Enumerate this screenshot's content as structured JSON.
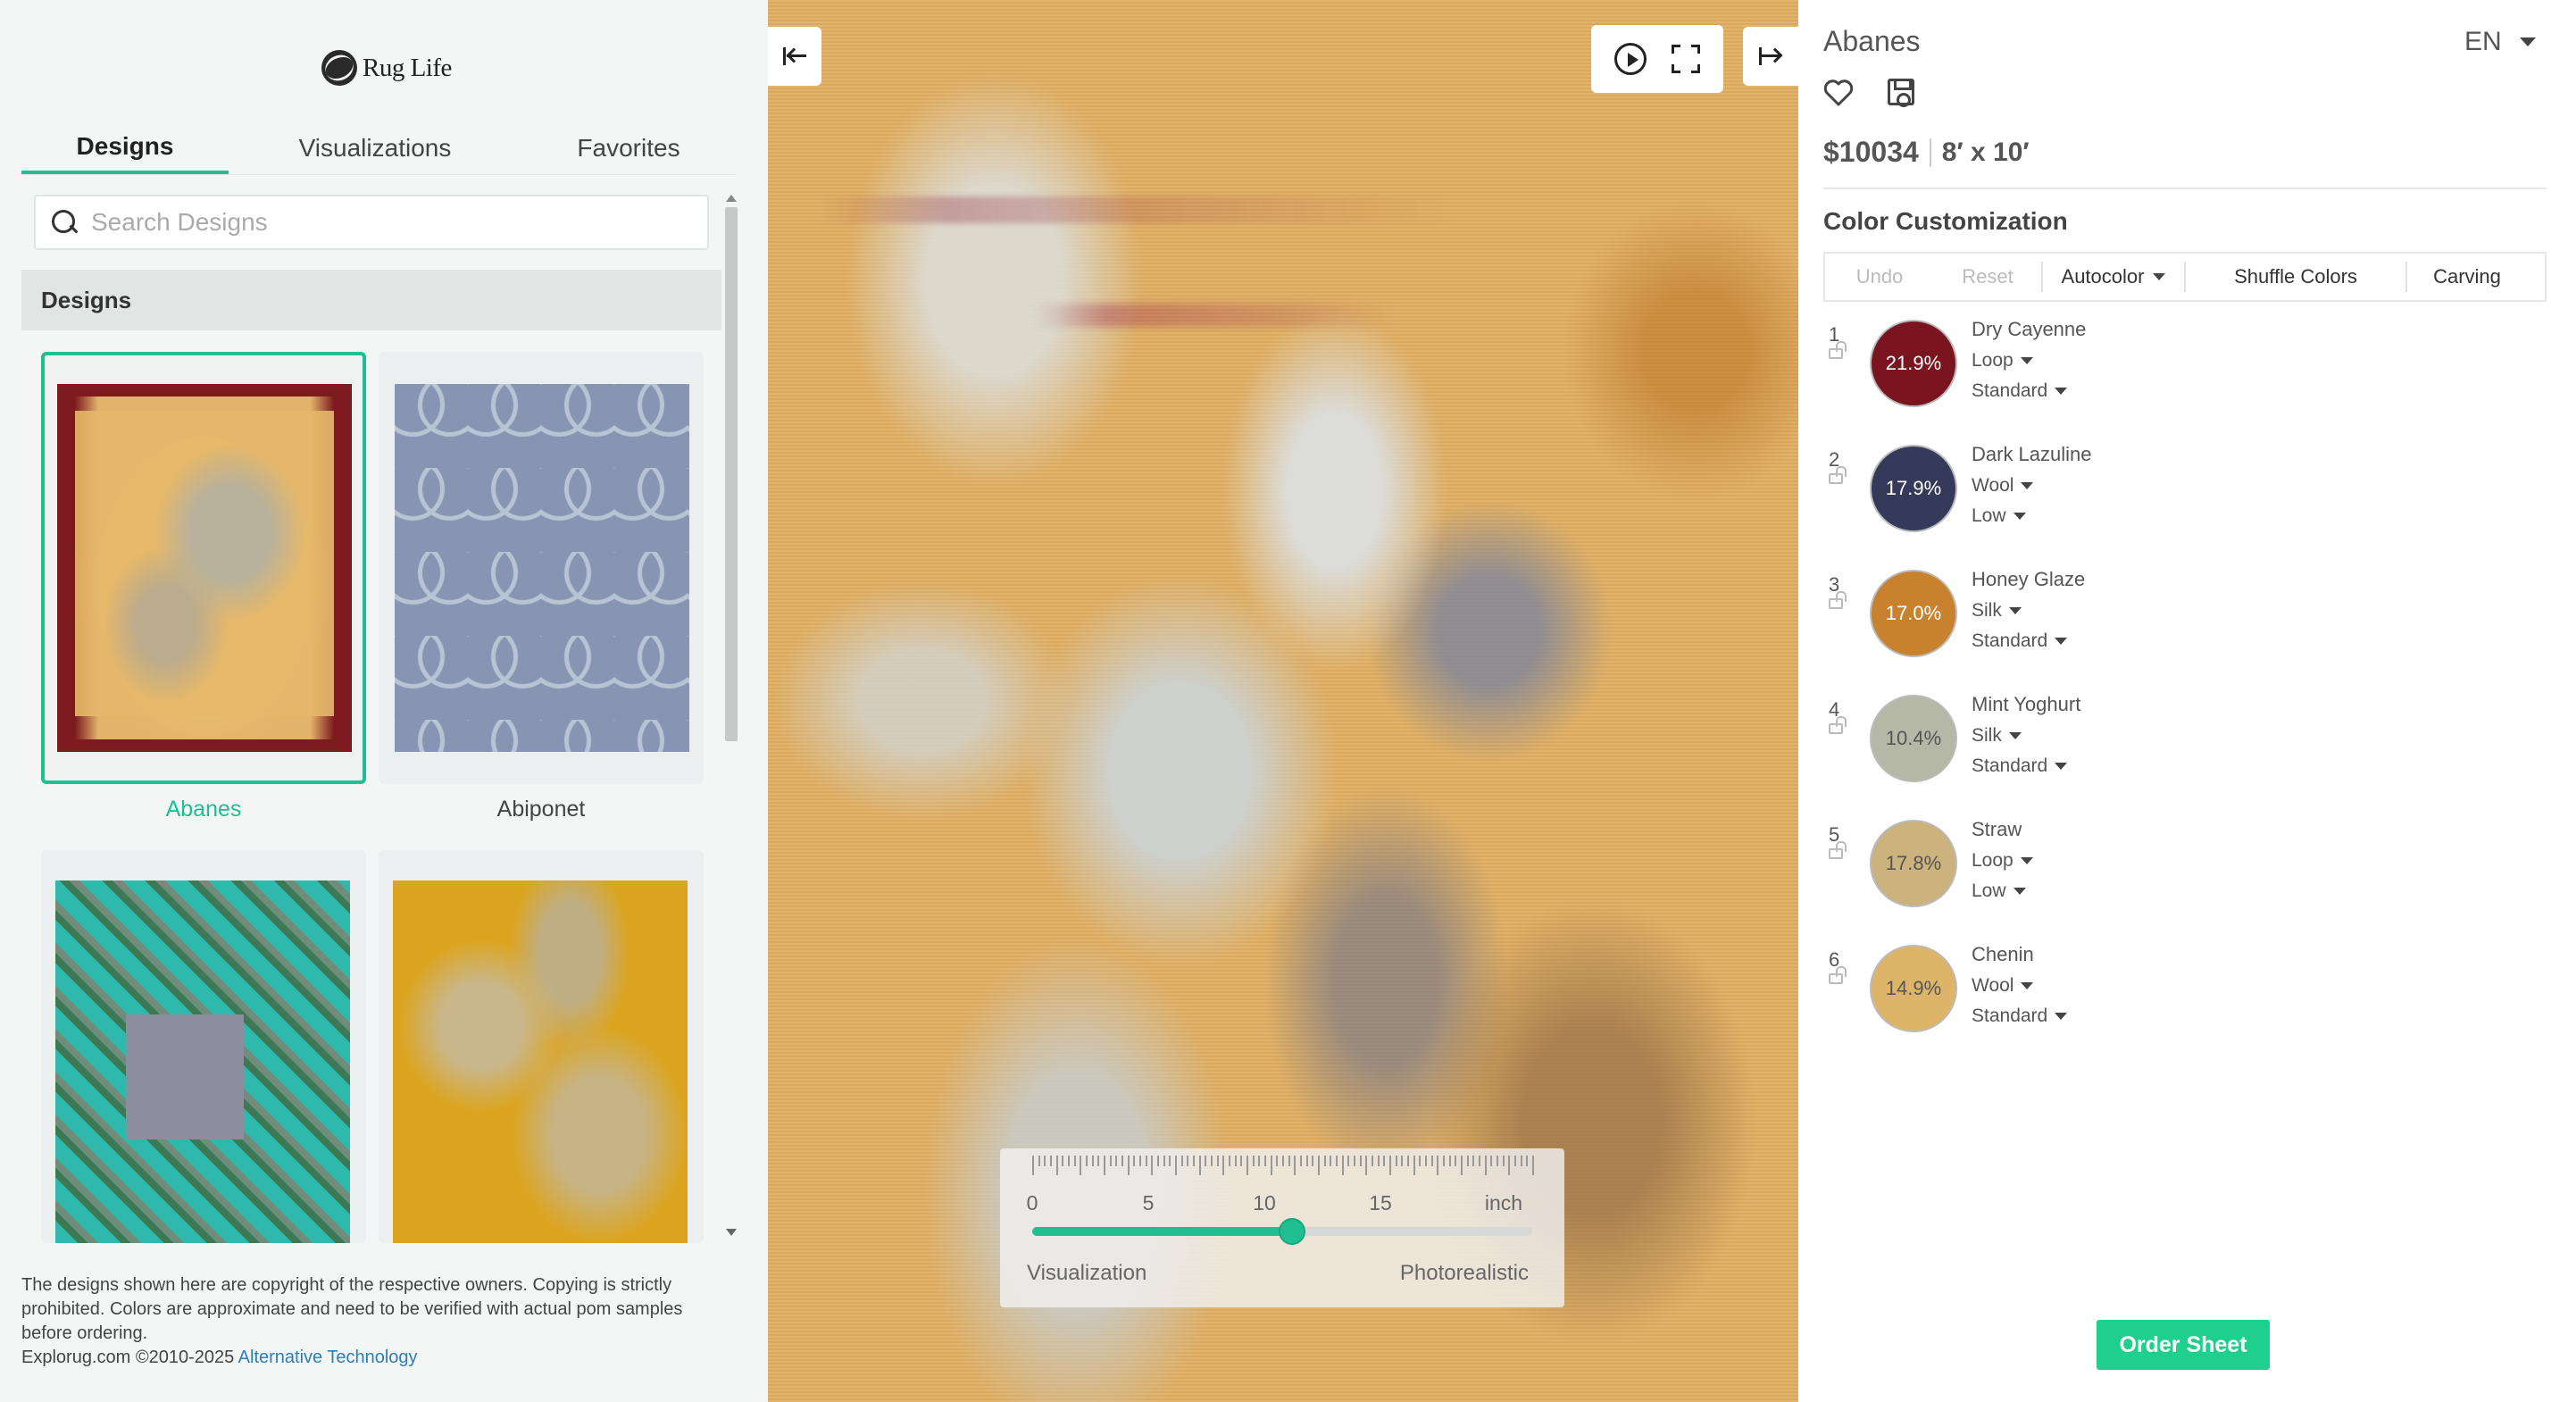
{
  "brand": {
    "logo_text": "Rug Life"
  },
  "left": {
    "tabs": [
      {
        "label": "Designs",
        "active": true
      },
      {
        "label": "Visualizations",
        "active": false
      },
      {
        "label": "Favorites",
        "active": false
      }
    ],
    "search": {
      "placeholder": "Search Designs",
      "value": ""
    },
    "section_header": "Designs",
    "designs": [
      {
        "name": "Abanes",
        "selected": true
      },
      {
        "name": "Abiponet",
        "selected": false
      },
      {
        "name": "",
        "selected": false
      },
      {
        "name": "",
        "selected": false
      }
    ],
    "copyright": {
      "text": "The designs shown here are copyright of the respective owners. Copying is strictly prohibited. Colors are approximate and need to be verified with actual pom samples before ordering.",
      "line2_prefix": "Explorug.com ©2010-2025 ",
      "link": "Alternative Technology"
    }
  },
  "viewer": {
    "ruler": {
      "labels": [
        "0",
        "5",
        "10",
        "15",
        "inch"
      ]
    },
    "slider": {
      "left_label": "Visualization",
      "right_label": "Photorealistic",
      "value_fraction": 0.52
    },
    "icons": [
      "collapse-left-icon",
      "play-icon",
      "fullscreen-icon",
      "collapse-right-icon"
    ]
  },
  "right": {
    "title": "Abanes",
    "language": "EN",
    "price": "$10034",
    "size": "8′ x 10′",
    "color_customization_title": "Color Customization",
    "toolbar": {
      "undo": "Undo",
      "reset": "Reset",
      "autocolor": "Autocolor",
      "shuffle": "Shuffle Colors",
      "carving": "Carving"
    },
    "colors": [
      {
        "index": "1",
        "name": "Dry Cayenne",
        "percent": "21.9%",
        "material": "Loop",
        "pile": "Standard",
        "hex": "#7a1520",
        "text_color": "#ffffff"
      },
      {
        "index": "2",
        "name": "Dark Lazuline",
        "percent": "17.9%",
        "material": "Wool",
        "pile": "Low",
        "hex": "#363a5a",
        "text_color": "#ffffff"
      },
      {
        "index": "3",
        "name": "Honey Glaze",
        "percent": "17.0%",
        "material": "Silk",
        "pile": "Standard",
        "hex": "#c8812c",
        "text_color": "#ffffff"
      },
      {
        "index": "4",
        "name": "Mint Yoghurt",
        "percent": "10.4%",
        "material": "Silk",
        "pile": "Standard",
        "hex": "#b5b8a6",
        "text_color": "#555555"
      },
      {
        "index": "5",
        "name": "Straw",
        "percent": "17.8%",
        "material": "Loop",
        "pile": "Low",
        "hex": "#ccb27c",
        "text_color": "#555555"
      },
      {
        "index": "6",
        "name": "Chenin",
        "percent": "14.9%",
        "material": "Wool",
        "pile": "Standard",
        "hex": "#ddb468",
        "text_color": "#555555"
      }
    ],
    "order_button": "Order Sheet"
  },
  "theme": {
    "accent": "#1fbf8f",
    "order_button": "#1fcf8e",
    "link": "#2a7fb8"
  }
}
